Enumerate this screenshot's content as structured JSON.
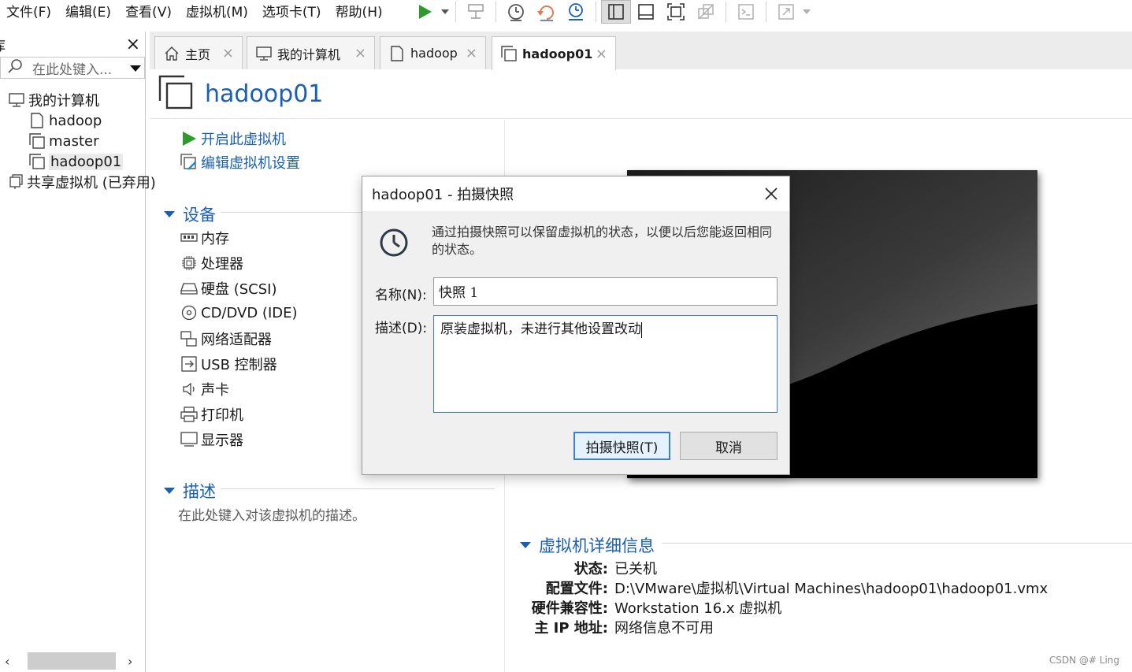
{
  "menubar": {
    "items": [
      "文件(F)",
      "编辑(E)",
      "查看(V)",
      "虚拟机(M)",
      "选项卡(T)",
      "帮助(H)"
    ]
  },
  "toolbar": {
    "icons": [
      "play-icon",
      "suspend-icon",
      "snapshot-take-icon",
      "snapshot-revert-icon",
      "snapshot-manager-icon",
      "library-view-icon",
      "thumbnail-bar-icon",
      "fullscreen-icon",
      "unity-icon",
      "console-icon",
      "stretch-icon"
    ]
  },
  "library": {
    "title": "库",
    "search_placeholder": "在此处键入...",
    "tree": [
      {
        "label": "我的计算机",
        "icon": "computer-icon",
        "indent": 0
      },
      {
        "label": "hadoop",
        "icon": "vm-icon",
        "indent": 1
      },
      {
        "label": "master",
        "icon": "vm-icon",
        "indent": 1
      },
      {
        "label": "hadoop01",
        "icon": "vm-icon",
        "indent": 1,
        "selected": true
      },
      {
        "label": "共享虚拟机 (已弃用)",
        "icon": "shared-vm-icon",
        "indent": 0
      }
    ]
  },
  "tabs": [
    {
      "label": "主页",
      "icon": "home-icon"
    },
    {
      "label": "我的计算机",
      "icon": "computer-icon"
    },
    {
      "label": "hadoop",
      "icon": "vm-icon"
    },
    {
      "label": "hadoop01",
      "icon": "vm-icon",
      "active": true
    }
  ],
  "vm": {
    "title": "hadoop01",
    "actions": {
      "power_on": "开启此虚拟机",
      "edit_settings": "编辑虚拟机设置"
    },
    "devices_heading": "设备",
    "devices": [
      {
        "label": "内存",
        "icon": "memory-icon"
      },
      {
        "label": "处理器",
        "icon": "processor-icon"
      },
      {
        "label": "硬盘 (SCSI)",
        "icon": "hard-disk-icon"
      },
      {
        "label": "CD/DVD (IDE)",
        "icon": "cd-dvd-icon"
      },
      {
        "label": "网络适配器",
        "icon": "network-adapter-icon"
      },
      {
        "label": "USB 控制器",
        "icon": "usb-icon"
      },
      {
        "label": "声卡",
        "icon": "sound-card-icon"
      },
      {
        "label": "打印机",
        "icon": "printer-icon"
      },
      {
        "label": "显示器",
        "icon": "display-icon"
      }
    ],
    "description_heading": "描述",
    "description_hint": "在此处键入对该虚拟机的描述。",
    "details_heading": "虚拟机详细信息",
    "details": [
      {
        "key": "状态:",
        "value": "已关机"
      },
      {
        "key": "配置文件:",
        "value": "D:\\VMware\\虚拟机\\Virtual Machines\\hadoop01\\hadoop01.vmx"
      },
      {
        "key": "硬件兼容性:",
        "value": "Workstation 16.x 虚拟机"
      },
      {
        "key": "主 IP 地址:",
        "value": "网络信息不可用"
      }
    ]
  },
  "dialog": {
    "title": "hadoop01 - 拍摄快照",
    "message": "通过拍摄快照可以保留虚拟机的状态，以便以后您能返回相同的状态。",
    "name_label": "名称(N):",
    "name_value": "快照 1",
    "desc_label": "描述(D):",
    "desc_value": "原装虚拟机，未进行其他设置改动",
    "take_button": "拍摄快照(T)",
    "cancel_button": "取消"
  },
  "watermark": "CSDN @# Ling",
  "colors": {
    "accent": "#1a5fb4",
    "play_green": "#2e9a2e"
  }
}
